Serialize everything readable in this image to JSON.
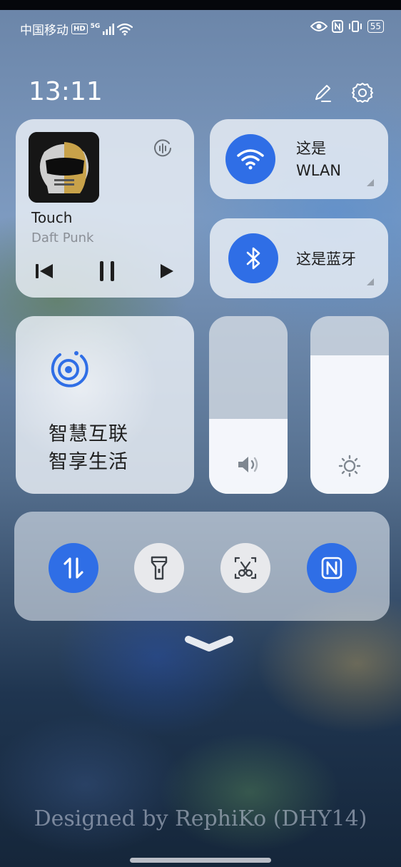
{
  "status_bar": {
    "carrier": "中国移动",
    "network_badge": "HD",
    "network_type": "5G",
    "battery": "55"
  },
  "header": {
    "time": "13:11",
    "edit_icon": "pencil-icon",
    "settings_icon": "gear-icon"
  },
  "media": {
    "title": "Touch",
    "artist": "Daft Punk",
    "cast_icon": "audio-output-icon"
  },
  "wlan": {
    "label_line1": "这是",
    "label_line2": "WLAN",
    "active": true
  },
  "bluetooth": {
    "label": "这是蓝牙",
    "active": true
  },
  "smart_connect": {
    "line1": "智慧互联",
    "line2": "智享生活"
  },
  "sliders": {
    "volume_level": 0.42,
    "brightness_level": 0.78
  },
  "quick_toggles": [
    {
      "name": "mobile-data-toggle",
      "icon": "data-arrows-icon",
      "active": true
    },
    {
      "name": "flashlight-toggle",
      "icon": "flashlight-icon",
      "active": false
    },
    {
      "name": "screenshot-toggle",
      "icon": "screenshot-scissors-icon",
      "active": false
    },
    {
      "name": "nfc-toggle",
      "icon": "nfc-icon",
      "active": true
    }
  ],
  "colors": {
    "accent": "#2f6ee6",
    "tile": "#ebf0f6",
    "text": "#1e1e1e",
    "muted": "#8a8f96"
  },
  "watermark": "Designed by RephiKo (DHY14)"
}
